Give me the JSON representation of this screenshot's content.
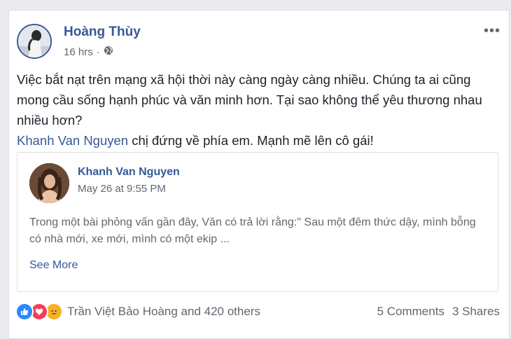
{
  "post": {
    "author": "Hoàng Thùy",
    "time": "16 hrs",
    "separator": "·",
    "text_main": "Việc bắt nạt trên mạng xã hội thời này càng ngày càng nhiều. Chúng ta ai cũng mong cầu sống hạnh phúc và văn minh hơn. Tại sao không thể yêu thương nhau nhiều hơn?",
    "mention": "Khanh Van Nguyen",
    "text_after_mention": " chị đứng về phía em. Mạnh mẽ lên cô gái!",
    "privacy_icon": "globe-icon",
    "menu_icon": "more-options-icon"
  },
  "shared": {
    "author": "Khanh Van Nguyen",
    "time": "May 26 at 9:55 PM",
    "text": "Trong một bài phỏng vấn gần đây, Vân có trả lời rằng:\" Sau một đêm thức dậy, mình bỗng có nhà mới, xe mới, mình có một ekip ...",
    "see_more": "See More"
  },
  "footer": {
    "reaction_names": "Trần Việt Bảo Hoàng and 420 others",
    "comments": "5 Comments",
    "shares": "3 Shares",
    "reactions": [
      "like",
      "love",
      "sad"
    ]
  },
  "colors": {
    "link": "#365899",
    "secondary_text": "#616770",
    "like": "#2d88ff",
    "love": "#f33e58",
    "sad": "#f7b125"
  }
}
